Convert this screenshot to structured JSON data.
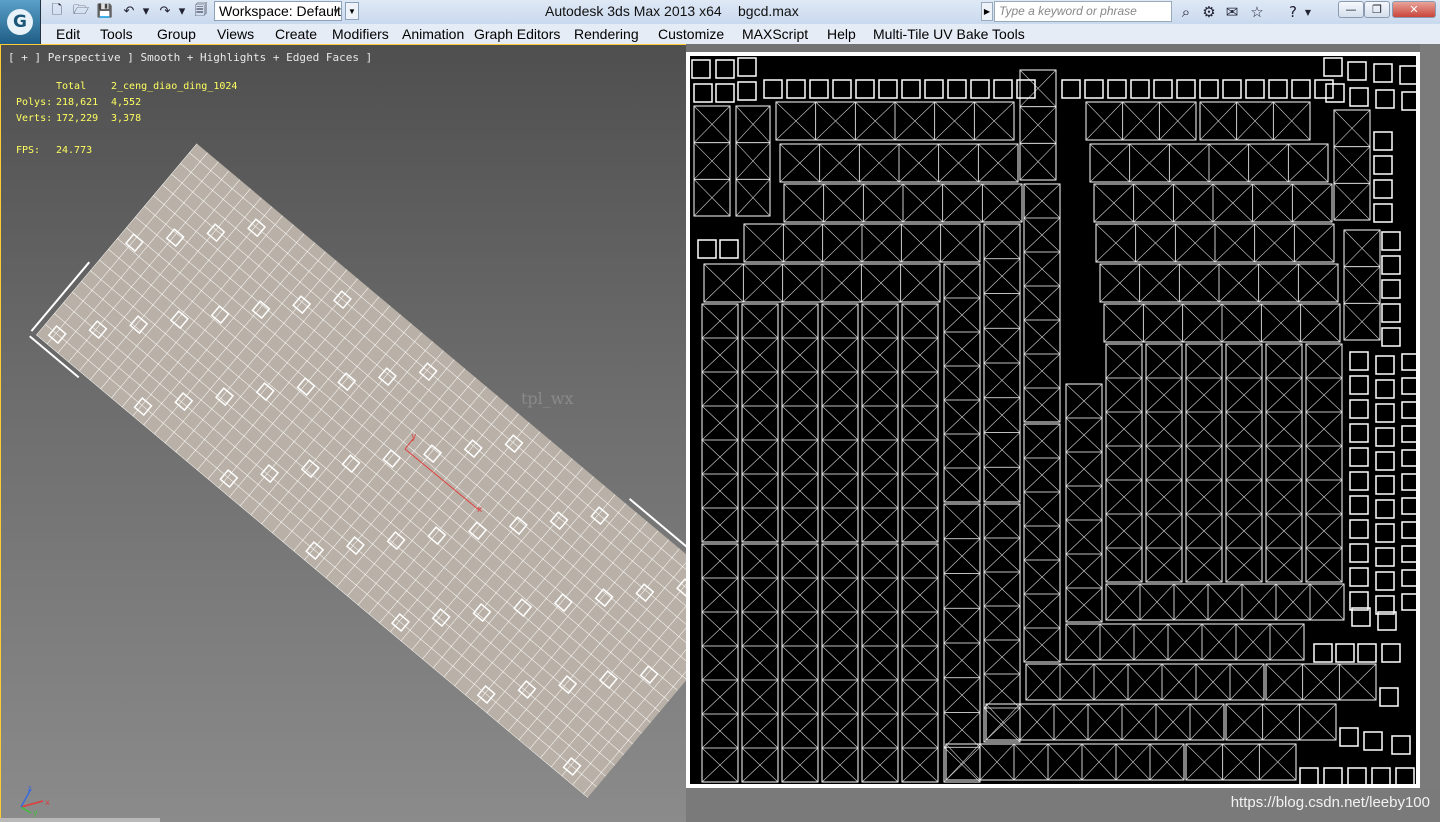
{
  "app_button": {
    "logo": "G"
  },
  "quick_access": [
    {
      "name": "new-file-icon",
      "glyph": "🗋"
    },
    {
      "name": "open-folder-icon",
      "glyph": "🗁"
    },
    {
      "name": "save-icon",
      "glyph": "💾"
    },
    {
      "name": "undo-icon",
      "glyph": "↶"
    },
    {
      "name": "undo-dropdown-icon",
      "glyph": "▾"
    },
    {
      "name": "redo-icon",
      "glyph": "↷"
    },
    {
      "name": "redo-dropdown-icon",
      "glyph": "▾"
    },
    {
      "name": "project-folder-icon",
      "glyph": "🗐"
    }
  ],
  "workspace": {
    "value": "Workspace: Default"
  },
  "title": {
    "app": "Autodesk 3ds Max  2013 x64",
    "file": "bgcd.max"
  },
  "search": {
    "placeholder": "Type a keyword or phrase"
  },
  "title_icons": [
    "binoculars-icon",
    "subscription-icon",
    "communication-icon",
    "favorites-star-icon",
    "help-icon"
  ],
  "window_buttons": {
    "minimize": "—",
    "restore": "❐",
    "close": "✕"
  },
  "menu": [
    "Edit",
    "Tools",
    "Group",
    "Views",
    "Create",
    "Modifiers",
    "Animation",
    "Graph Editors",
    "Rendering",
    "Customize",
    "MAXScript",
    "Help",
    "Multi-Tile UV Bake Tools"
  ],
  "viewport": {
    "label": "[ + ] Perspective ] Smooth + Highlights + Edged Faces ]",
    "stats": {
      "header_total": "Total",
      "header_object": "2_ceng_diao_ding_1024",
      "polys_label": "Polys:",
      "polys_total": "218,621",
      "polys_object": "4,552",
      "verts_label": "Verts:",
      "verts_total": "172,229",
      "verts_object": "3,378",
      "fps_label": "FPS:",
      "fps_value": "24.773"
    },
    "overlay_text": "tpl_wx",
    "gizmo_labels": {
      "x": "x",
      "y": "y"
    },
    "axis_tripod": {
      "x": "x",
      "y": "y",
      "z": "z"
    }
  },
  "watermark": "https://blog.csdn.net/leeby100",
  "colors": {
    "viewport_border": "#ffcc33",
    "stats_text": "#ffff60",
    "uv_bg": "#000000",
    "uv_lines": "#ffffff",
    "mesh_fill": "#b8b0a6"
  }
}
